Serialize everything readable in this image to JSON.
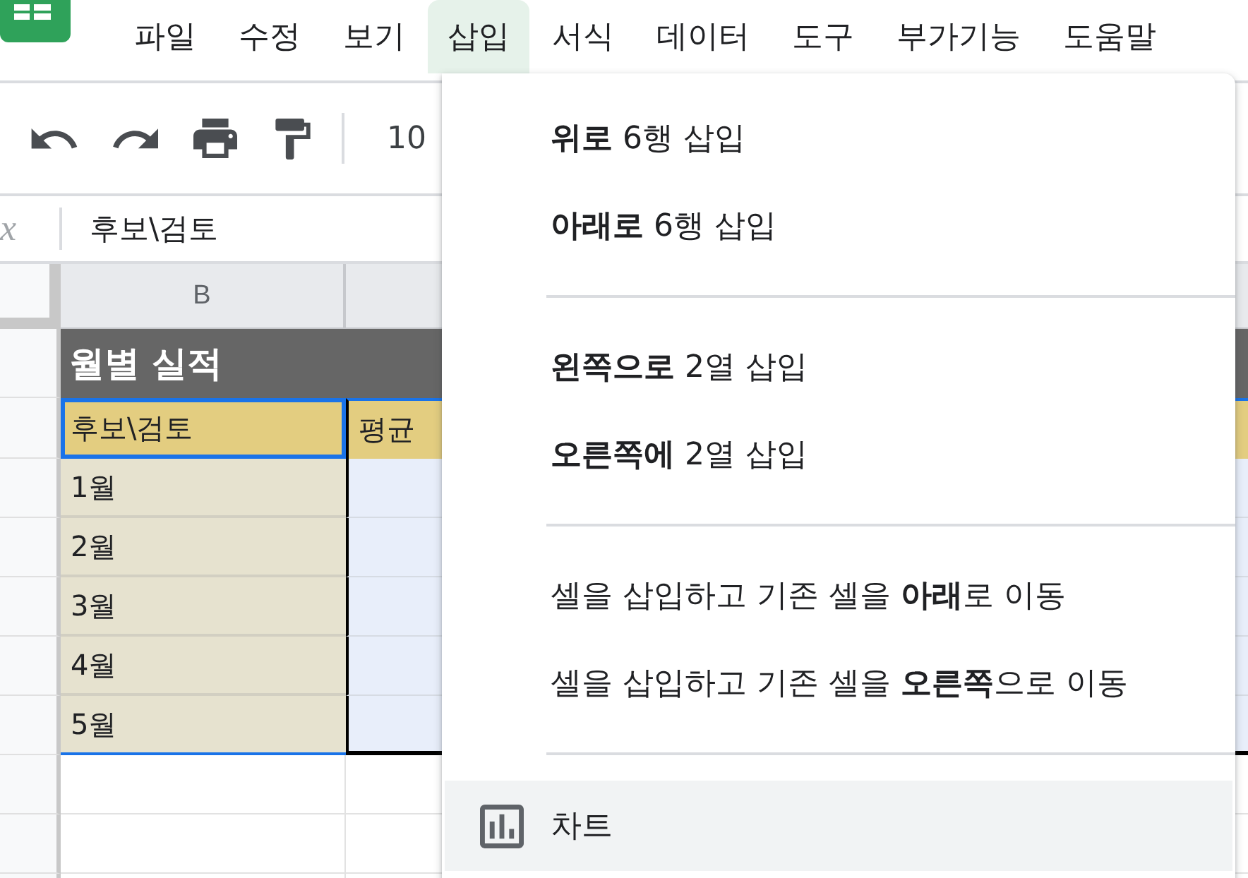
{
  "app_menu": [
    {
      "label": "파일",
      "selected": false
    },
    {
      "label": "수정",
      "selected": false
    },
    {
      "label": "보기",
      "selected": false
    },
    {
      "label": "삽입",
      "selected": true
    },
    {
      "label": "서식",
      "selected": false
    },
    {
      "label": "데이터",
      "selected": false
    },
    {
      "label": "도구",
      "selected": false
    },
    {
      "label": "부가기능",
      "selected": false
    },
    {
      "label": "도움말",
      "selected": false
    }
  ],
  "toolbar": {
    "zoom": "10"
  },
  "formula_bar": {
    "label": "x",
    "value": "후보\\검토"
  },
  "sheet": {
    "column_headers": [
      "B"
    ],
    "title": "월별 실적",
    "header_row": [
      {
        "text": "후보\\검토",
        "selected": true
      },
      {
        "text": "평균",
        "selected": false
      }
    ],
    "rows": [
      {
        "label": "1월",
        "selected": true
      },
      {
        "label": "2월",
        "selected": true
      },
      {
        "label": "3월",
        "selected": true
      },
      {
        "label": "4월",
        "selected": true
      },
      {
        "label": "5월",
        "selected": true
      }
    ]
  },
  "insert_menu": {
    "groups": [
      {
        "items": [
          {
            "kind": "insert",
            "label": "**위로** 6행 삽입",
            "highlighted": false
          },
          {
            "kind": "insert",
            "label": "**아래로** 6행 삽입",
            "highlighted": false
          }
        ]
      },
      {
        "items": [
          {
            "kind": "insert",
            "label": "**왼쪽으로** 2열 삽입",
            "highlighted": false
          },
          {
            "kind": "insert",
            "label": "**오른쪽에** 2열 삽입",
            "highlighted": false
          }
        ]
      },
      {
        "items": [
          {
            "kind": "insert",
            "label": "셀을 삽입하고 기존 셀을 **아래**로 이동",
            "highlighted": false
          },
          {
            "kind": "insert",
            "label": "셀을 삽입하고 기존 셀을 **오른쪽**으로 이동",
            "highlighted": false
          }
        ]
      },
      {
        "items": [
          {
            "kind": "chart",
            "label": "차트",
            "highlighted": true
          }
        ]
      }
    ]
  }
}
